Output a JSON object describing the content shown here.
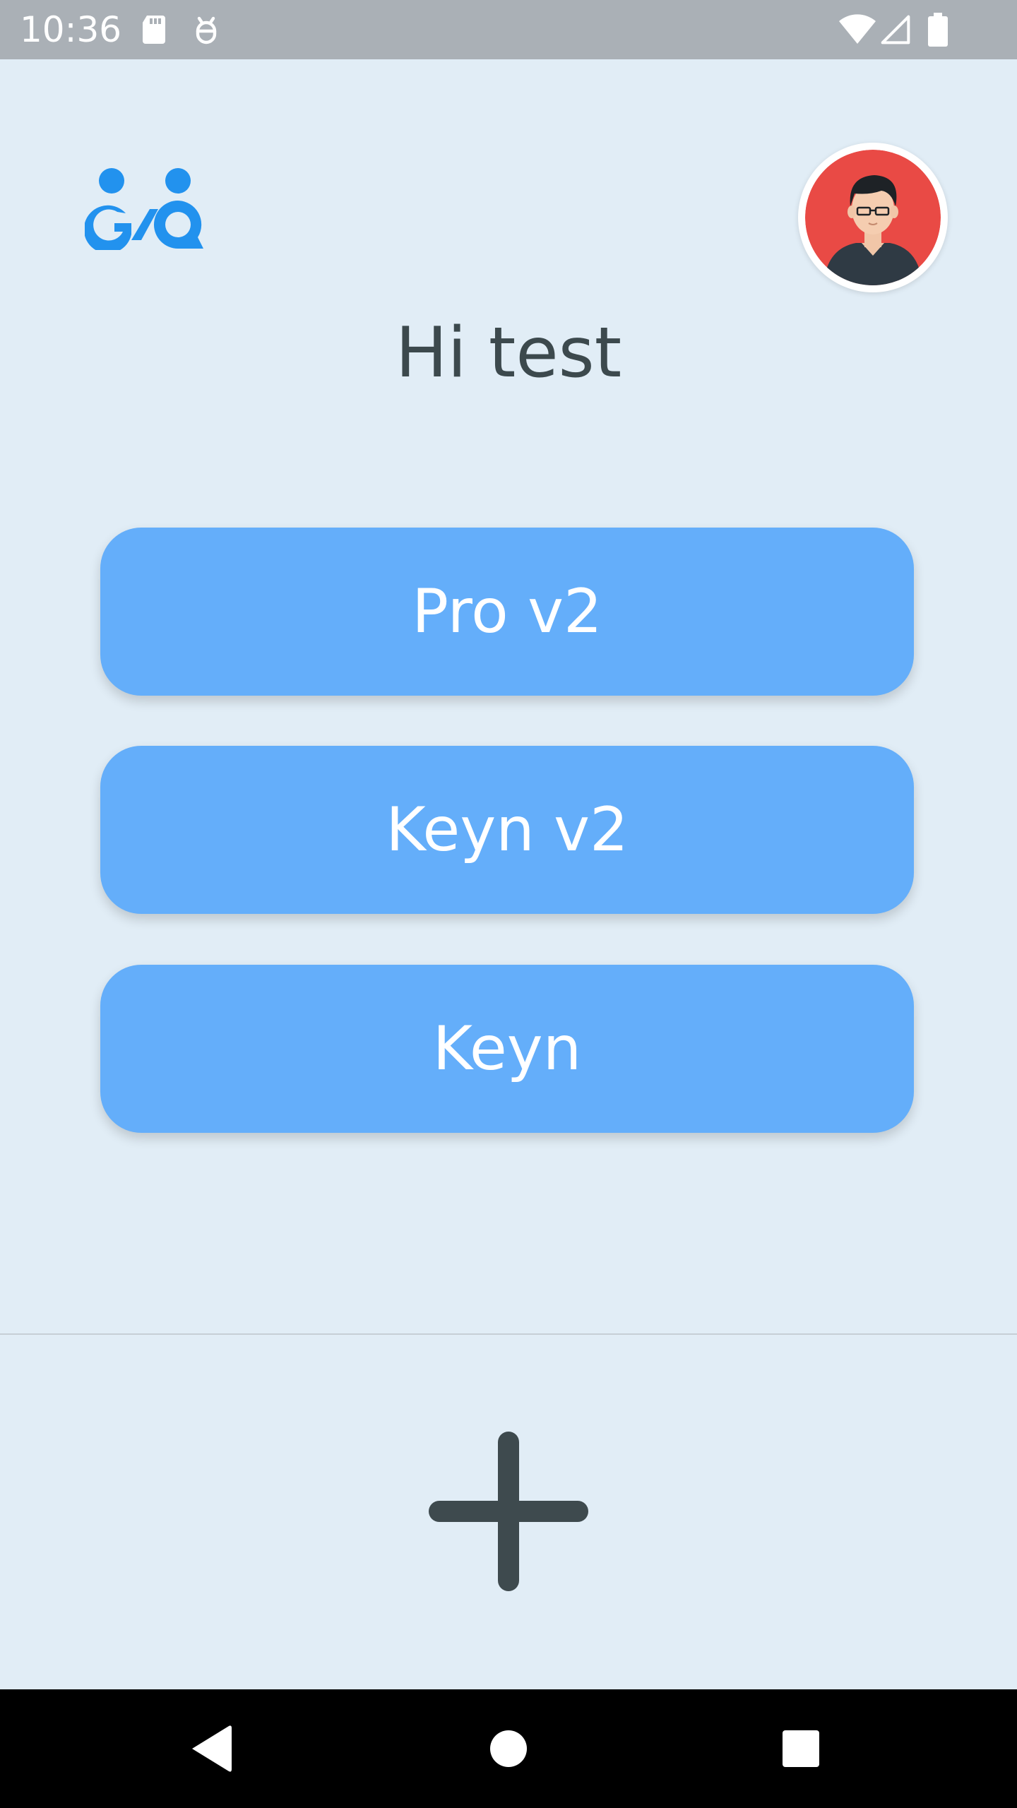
{
  "status_bar": {
    "time": "10:36",
    "icons": [
      "sd-card-icon",
      "debug-icon",
      "wifi-icon",
      "signal-icon",
      "battery-icon"
    ]
  },
  "header": {
    "logo_icon": "app-logo-icon",
    "avatar_icon": "avatar-icon"
  },
  "greeting": "Hi test",
  "menu": {
    "items": [
      {
        "label": "Pro v2"
      },
      {
        "label": "Keyn v2"
      },
      {
        "label": "Keyn"
      }
    ]
  },
  "actions": {
    "add_icon": "plus-icon"
  },
  "nav": {
    "icons": [
      "back-icon",
      "home-icon",
      "recents-icon"
    ]
  },
  "colors": {
    "background": "#e1edf6",
    "status_bar": "#aab0b6",
    "button": "#64aefa",
    "button_text": "#ffffff",
    "text": "#3c494d",
    "logo": "#2292ee",
    "avatar_bg": "#e94a45"
  }
}
